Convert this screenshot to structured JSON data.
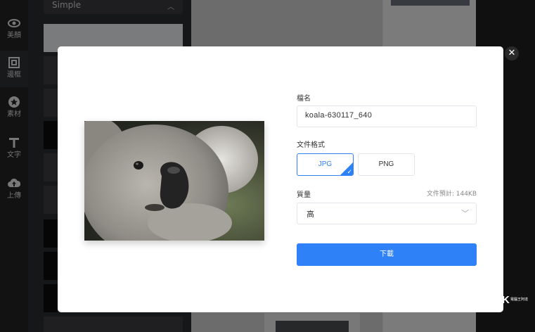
{
  "rail": {
    "items": [
      {
        "label": "美顏",
        "icon": "eye-icon"
      },
      {
        "label": "邊框",
        "icon": "frame-icon"
      },
      {
        "label": "素材",
        "icon": "star-icon"
      },
      {
        "label": "文字",
        "icon": "text-icon"
      },
      {
        "label": "上傳",
        "icon": "upload-cloud-icon"
      }
    ]
  },
  "panel": {
    "style_select": "Simple"
  },
  "dialog": {
    "filename_label": "檔名",
    "filename_value": "koala-630117_640",
    "format_label": "文件格式",
    "formats": [
      "JPG",
      "PNG"
    ],
    "selected_format": "JPG",
    "quality_label": "質量",
    "estimated_size": "文件預計: 144KB",
    "quality_value": "高",
    "download_label": "下載",
    "close_icon": "close-icon"
  },
  "watermark": {
    "brand": "K",
    "text": "電腦王阿達"
  },
  "colors": {
    "accent": "#2f81f7",
    "modal_bg": "#ffffff",
    "rail_bg": "#232426"
  }
}
